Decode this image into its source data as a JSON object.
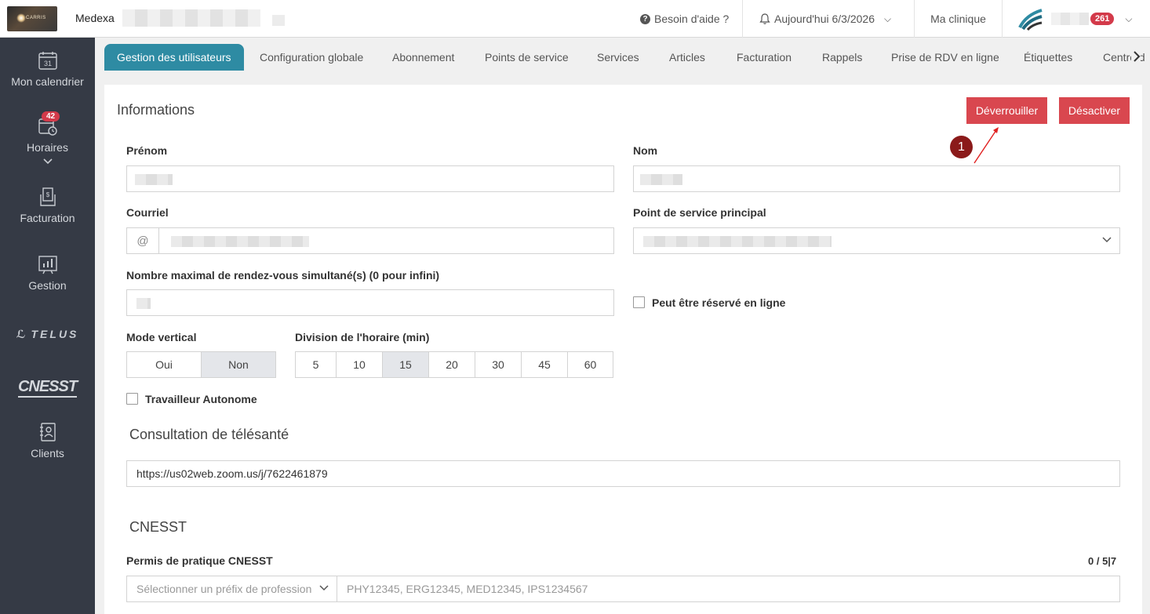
{
  "topbar": {
    "logo_text": "CARRIS",
    "clinic_name": "Medexa",
    "help_label": "Besoin d'aide ?",
    "today_label": "Aujourd'hui 6/3/2026",
    "my_clinic_label": "Ma clinique",
    "notification_count": "261"
  },
  "sidebar": {
    "calendar_day": "31",
    "items": [
      {
        "label": "Mon calendrier"
      },
      {
        "label": "Horaires",
        "badge": "42"
      },
      {
        "label": "Facturation"
      },
      {
        "label": "Gestion"
      },
      {
        "label": "Clients"
      }
    ],
    "telus_label": "TELUS",
    "cnesst_label": "CNESST"
  },
  "tabs": [
    "Gestion des utilisateurs",
    "Configuration globale",
    "Abonnement",
    "Points de service",
    "Services",
    "Articles",
    "Facturation",
    "Rappels",
    "Prise de RDV en ligne",
    "Étiquettes",
    "Centre d"
  ],
  "form": {
    "title": "Informations",
    "unlock_label": "Déverrouiller",
    "deactivate_label": "Désactiver",
    "annotation_step": "1",
    "first_name_label": "Prénom",
    "last_name_label": "Nom",
    "email_label": "Courriel",
    "email_prefix": "@",
    "main_service_point_label": "Point de service principal",
    "max_appointments_label": "Nombre maximal de rendez-vous simultané(s) (0 pour infini)",
    "online_booking_label": "Peut être réservé en ligne",
    "vertical_mode_label": "Mode vertical",
    "vertical_mode_options": [
      "Oui",
      "Non"
    ],
    "schedule_division_label": "Division de l'horaire (min)",
    "schedule_division_options": [
      "5",
      "10",
      "15",
      "20",
      "30",
      "45",
      "60"
    ],
    "autonomous_worker_label": "Travailleur Autonome"
  },
  "telehealth": {
    "title": "Consultation de télésanté",
    "url": "https://us02web.zoom.us/j/7622461879"
  },
  "cnesst": {
    "title": "CNESST",
    "permit_label": "Permis de pratique CNESST",
    "counter": "0 / 5|7",
    "prefix_placeholder": "Sélectionner un préfix de profession",
    "permit_placeholder": "PHY12345, ERG12345, MED12345, IPS1234567"
  },
  "colors": {
    "active_tab": "#2e8ba3",
    "danger_button": "#d9474f",
    "sidebar_bg": "#353a45",
    "badge": "#d33a4a",
    "annotation": "#8b1a1a"
  }
}
